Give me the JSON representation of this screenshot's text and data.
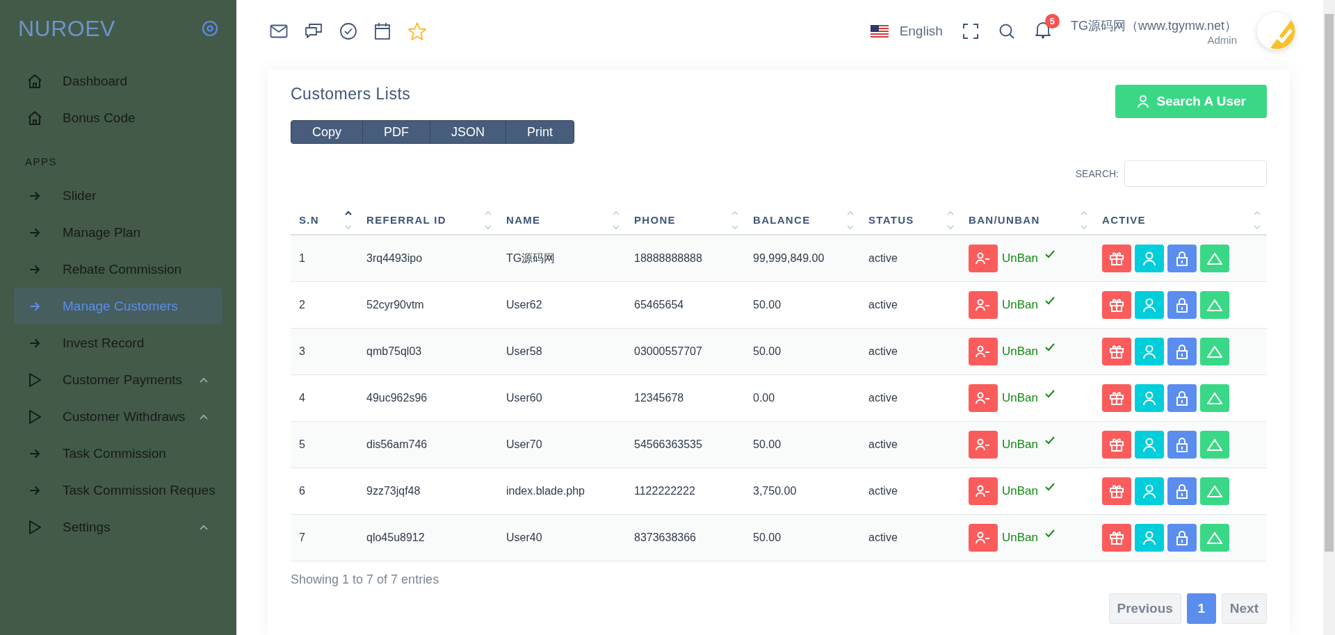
{
  "sidebar": {
    "logo": "NUROEV",
    "items": [
      {
        "kind": "home",
        "label": "Dashboard",
        "selected": false
      },
      {
        "kind": "home",
        "label": "Bonus Code",
        "selected": false
      },
      {
        "kind": "section",
        "label": "APPS"
      },
      {
        "kind": "arrow",
        "label": "Slider",
        "selected": false
      },
      {
        "kind": "arrow",
        "label": "Manage Plan",
        "selected": false
      },
      {
        "kind": "arrow",
        "label": "Rebate Commission",
        "selected": false
      },
      {
        "kind": "arrow",
        "label": "Manage Customers",
        "selected": true
      },
      {
        "kind": "arrow",
        "label": "Invest Record",
        "selected": false
      },
      {
        "kind": "play",
        "label": "Customer Payments",
        "selected": false,
        "expandable": true
      },
      {
        "kind": "play",
        "label": "Customer Withdraws",
        "selected": false,
        "expandable": true
      },
      {
        "kind": "arrow",
        "label": "Task Commission",
        "selected": false
      },
      {
        "kind": "arrow",
        "label": "Task Commission Reques",
        "selected": false
      },
      {
        "kind": "play",
        "label": "Settings",
        "selected": false,
        "expandable": true
      }
    ]
  },
  "topbar": {
    "language": "English",
    "notifications": "5",
    "user_name": "TG源码网（www.tgymw.net）",
    "user_role": "Admin"
  },
  "card": {
    "title": "Customers Lists",
    "export_buttons": [
      "Copy",
      "PDF",
      "JSON",
      "Print"
    ],
    "search_user_button": "Search A User",
    "search_label": "SEARCH:"
  },
  "table": {
    "columns": [
      {
        "label": "S.N",
        "sorted": true
      },
      {
        "label": "REFERRAL ID",
        "sorted": false
      },
      {
        "label": "NAME",
        "sorted": false
      },
      {
        "label": "PHONE",
        "sorted": false
      },
      {
        "label": "BALANCE",
        "sorted": false
      },
      {
        "label": "STATUS",
        "sorted": false
      },
      {
        "label": "BAN/UNBAN",
        "sorted": false
      },
      {
        "label": "ACTIVE",
        "sorted": false
      }
    ],
    "rows": [
      {
        "sn": "1",
        "referral_id": "3rq4493ipo",
        "name": "TG源码网",
        "phone": "18888888888",
        "balance": "99,999,849.00",
        "status": "active",
        "ban_action": "UnBan"
      },
      {
        "sn": "2",
        "referral_id": "52cyr90vtm",
        "name": "User62",
        "phone": "65465654",
        "balance": "50.00",
        "status": "active",
        "ban_action": "UnBan"
      },
      {
        "sn": "3",
        "referral_id": "qmb75ql03",
        "name": "User58",
        "phone": "03000557707",
        "balance": "50.00",
        "status": "active",
        "ban_action": "UnBan"
      },
      {
        "sn": "4",
        "referral_id": "49uc962s96",
        "name": "User60",
        "phone": "12345678",
        "balance": "0.00",
        "status": "active",
        "ban_action": "UnBan"
      },
      {
        "sn": "5",
        "referral_id": "dis56am746",
        "name": "User70",
        "phone": "54566363535",
        "balance": "50.00",
        "status": "active",
        "ban_action": "UnBan"
      },
      {
        "sn": "6",
        "referral_id": "9zz73jqf48",
        "name": "index.blade.php",
        "phone": "1122222222",
        "balance": "3,750.00",
        "status": "active",
        "ban_action": "UnBan"
      },
      {
        "sn": "7",
        "referral_id": "qlo45u8912",
        "name": "User40",
        "phone": "8373638366",
        "balance": "50.00",
        "status": "active",
        "ban_action": "UnBan"
      }
    ]
  },
  "footer": {
    "info": "Showing 1 to 7 of 7 entries",
    "pagination": {
      "previous": "Previous",
      "pages": [
        {
          "label": "1",
          "selected": true
        }
      ],
      "next": "Next"
    }
  }
}
